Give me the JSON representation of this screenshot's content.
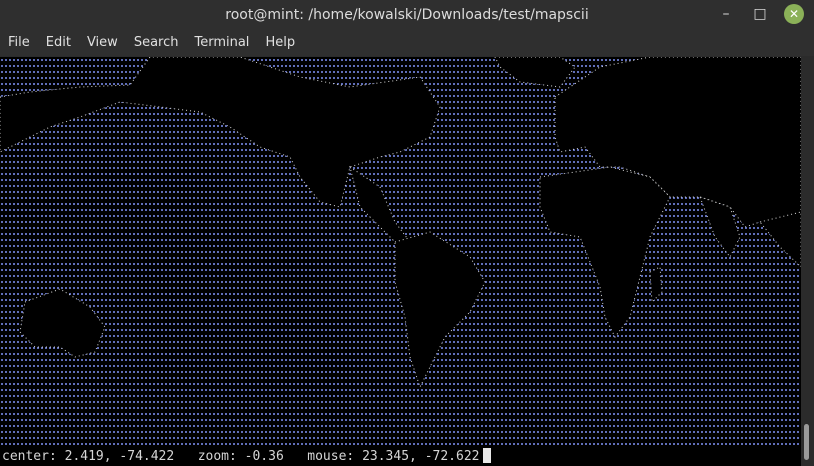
{
  "window": {
    "title": "root@mint: /home/kowalski/Downloads/test/mapscii"
  },
  "menu": [
    "File",
    "Edit",
    "View",
    "Search",
    "Terminal",
    "Help"
  ],
  "status": {
    "center_label": "center:",
    "center_value": "2.419, -74.422",
    "zoom_label": "zoom:",
    "zoom_value": "-0.36",
    "mouse_label": "mouse:",
    "mouse_value": "23.345, -72.622"
  },
  "colors": {
    "ocean_dots": "#6f7fd6",
    "land": "#000000",
    "borders": "#d8d8d8",
    "close_button": "#8bb158"
  },
  "icons": {
    "minimize": "minimize-icon",
    "maximize": "maximize-icon",
    "close": "close-icon"
  }
}
